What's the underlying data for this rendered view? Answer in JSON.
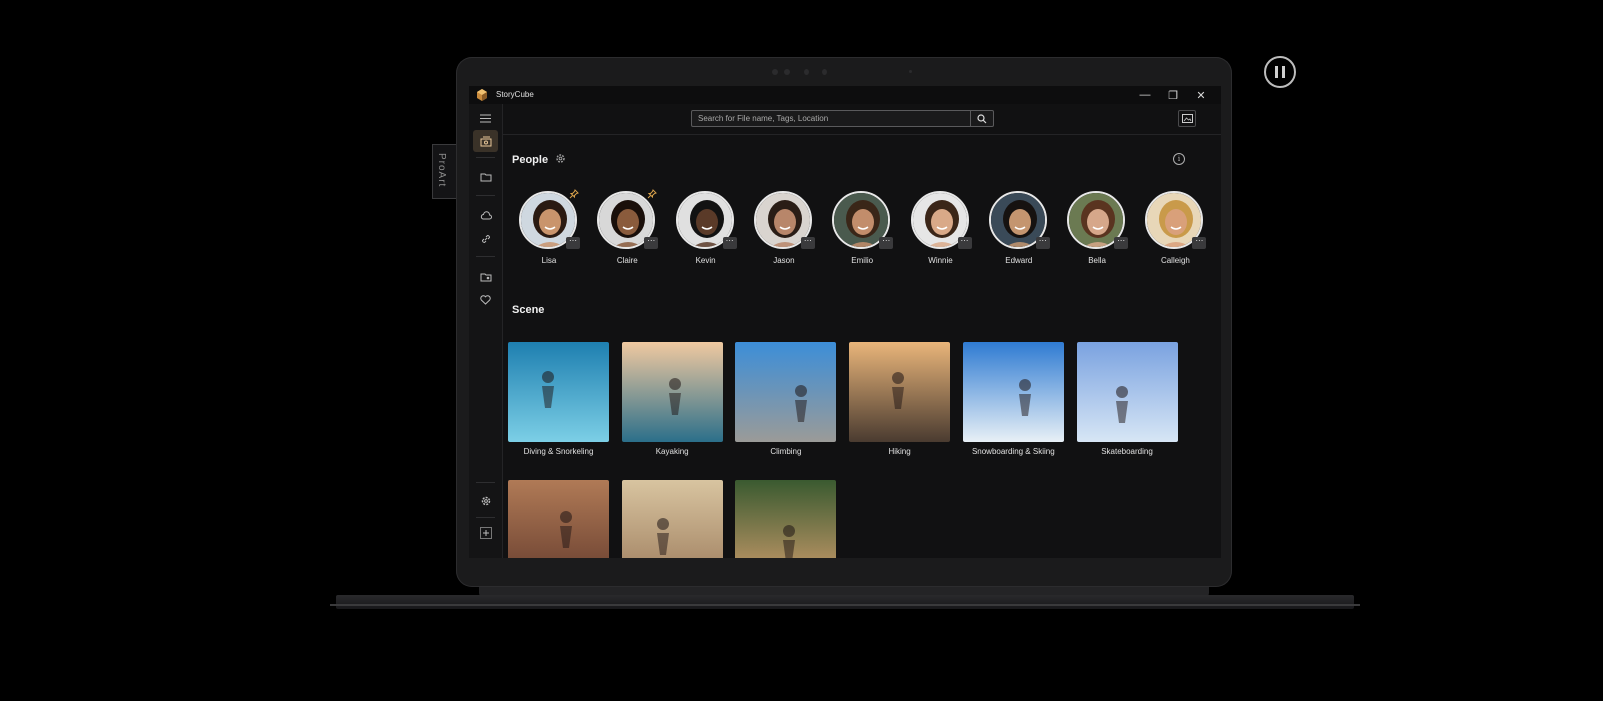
{
  "app": {
    "title": "StoryCube"
  },
  "side_tab": {
    "label": "ProArt"
  },
  "window_controls": {
    "minimize": "—",
    "restore": "❐",
    "close": "✕"
  },
  "search": {
    "placeholder": "Search for File name, Tags, Location"
  },
  "people": {
    "title": "People",
    "items": [
      {
        "name": "Lisa",
        "pinned": true,
        "skin": "#c9946c",
        "hair": "#2a1a12",
        "bg": "#cfd8e0"
      },
      {
        "name": "Claire",
        "pinned": true,
        "skin": "#8a5b3c",
        "hair": "#1a0f0a",
        "bg": "#d8d8d8"
      },
      {
        "name": "Kevin",
        "pinned": false,
        "skin": "#5a3a28",
        "hair": "#121212",
        "bg": "#e0e0e0"
      },
      {
        "name": "Jason",
        "pinned": false,
        "skin": "#b8866a",
        "hair": "#2a1d16",
        "bg": "#d9d4cf"
      },
      {
        "name": "Emilio",
        "pinned": false,
        "skin": "#c28d6b",
        "hair": "#3a2618",
        "bg": "#4a5a4e"
      },
      {
        "name": "Winnie",
        "pinned": false,
        "skin": "#d9a988",
        "hair": "#3b2618",
        "bg": "#e6e6e6"
      },
      {
        "name": "Edward",
        "pinned": false,
        "skin": "#c4956f",
        "hair": "#161210",
        "bg": "#3a4a58"
      },
      {
        "name": "Bella",
        "pinned": false,
        "skin": "#d6a78a",
        "hair": "#5a3420",
        "bg": "#6b7a52"
      },
      {
        "name": "Calleigh",
        "pinned": false,
        "skin": "#d9a07a",
        "hair": "#c99a4a",
        "bg": "#e8d7b8"
      }
    ]
  },
  "scene": {
    "title": "Scene",
    "items": [
      {
        "name": "Diving & Snorkeling",
        "top": "#1e7fb0",
        "bottom": "#7ccfe6"
      },
      {
        "name": "Kayaking",
        "top": "#f0c9a0",
        "bottom": "#2b6f8a"
      },
      {
        "name": "Climbing",
        "top": "#3c8ed8",
        "bottom": "#9b9b98"
      },
      {
        "name": "Hiking",
        "top": "#e9b57a",
        "bottom": "#4a3b30"
      },
      {
        "name": "Snowboarding & Skiing",
        "top": "#2f7bd2",
        "bottom": "#e8f0f6"
      },
      {
        "name": "Skateboarding",
        "top": "#7aa2e0",
        "bottom": "#d7e6f5"
      },
      {
        "name": "",
        "top": "#b07a56",
        "bottom": "#6a4030"
      },
      {
        "name": "",
        "top": "#d8c4a0",
        "bottom": "#a08060"
      },
      {
        "name": "",
        "top": "#3a5a30",
        "bottom": "#c89a6a"
      }
    ]
  },
  "colors": {
    "accent": "#d9a24b",
    "background": "#111112"
  }
}
